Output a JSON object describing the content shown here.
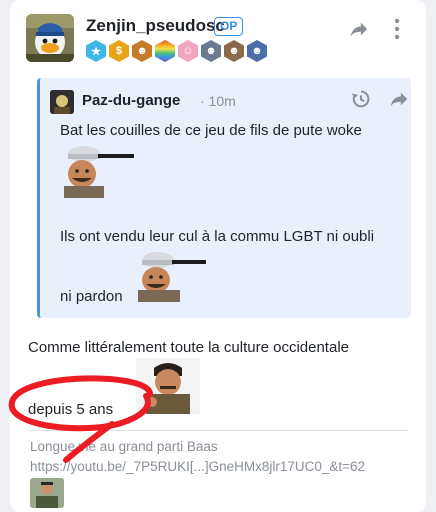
{
  "post": {
    "author": "Zenjin_pseudosc",
    "op_label": "OP",
    "icons": {
      "share": "share-arrow-icon",
      "menu": "more-vertical-icon"
    },
    "badges": [
      {
        "name": "star-badge",
        "glyph": "★",
        "color": "#3fb6e8"
      },
      {
        "name": "dollar-badge",
        "glyph": "$",
        "color": "#e8a317"
      },
      {
        "name": "mascot-badge",
        "glyph": "☻",
        "color": "#c77b2a"
      },
      {
        "name": "rainbow-badge",
        "glyph": "",
        "color": "#e24d6a"
      },
      {
        "name": "baby-badge",
        "glyph": "☺",
        "color": "#f0a6c0"
      },
      {
        "name": "face-badge-1",
        "glyph": "☻",
        "color": "#6b7a8f"
      },
      {
        "name": "face-badge-2",
        "glyph": "☻",
        "color": "#8a6a4a"
      },
      {
        "name": "face-badge-3",
        "glyph": "☻",
        "color": "#4a6fa8"
      }
    ],
    "quote": {
      "author": "Paz-du-gange",
      "time": "· 10m",
      "line1": "Bat les couilles de ce jeu de fils de pute woke",
      "line2": "Ils ont vendu leur cul à la commu LGBT ni oubli",
      "line3": "ni pardon",
      "icons": {
        "history": "history-icon",
        "share": "share-arrow-icon"
      }
    },
    "body_line1": "Comme littéralement toute la culture occidentale",
    "body_line2": "depuis 5 ans",
    "link": {
      "title": "Longue vie au grand parti Baas",
      "url": "https://youtu.be/_7P5RUKI[...]GneHMx8jlr17UC0_&t=62"
    }
  }
}
